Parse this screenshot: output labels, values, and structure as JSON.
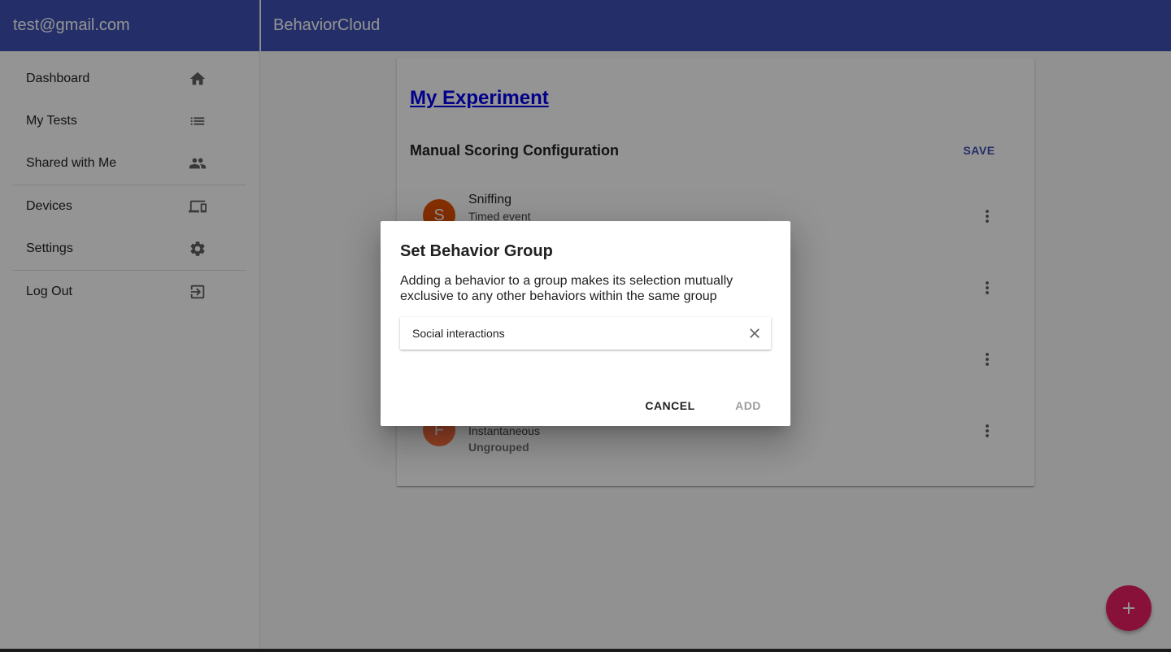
{
  "drawer": {
    "user_email": "test@gmail.com",
    "items": [
      {
        "label": "Dashboard",
        "icon": "home-icon"
      },
      {
        "label": "My Tests",
        "icon": "list-icon"
      },
      {
        "label": "Shared with Me",
        "icon": "people-icon"
      },
      {
        "label": "Devices",
        "icon": "devices-icon"
      },
      {
        "label": "Settings",
        "icon": "gear-icon"
      },
      {
        "label": "Log Out",
        "icon": "exit-icon"
      }
    ]
  },
  "appbar": {
    "title": "BehaviorCloud"
  },
  "card": {
    "experiment_title": "My Experiment",
    "section_title": "Manual Scoring Configuration",
    "save_label": "SAVE",
    "behaviors": [
      {
        "initial": "S",
        "name": "Sniffing",
        "type": "Timed event",
        "group": "",
        "color": "#e65100"
      },
      {
        "initial": "F",
        "name": "",
        "type": "Instantaneous",
        "group": "Ungrouped",
        "color": "#ff7043"
      }
    ]
  },
  "dialog": {
    "title": "Set Behavior Group",
    "description": "Adding a behavior to a group makes its selection mutually exclusive to any other behaviors within the same group",
    "input_value": "Social interactions",
    "cancel_label": "CANCEL",
    "add_label": "ADD"
  },
  "colors": {
    "primary": "#3f51b5",
    "accent": "#e91e63"
  }
}
